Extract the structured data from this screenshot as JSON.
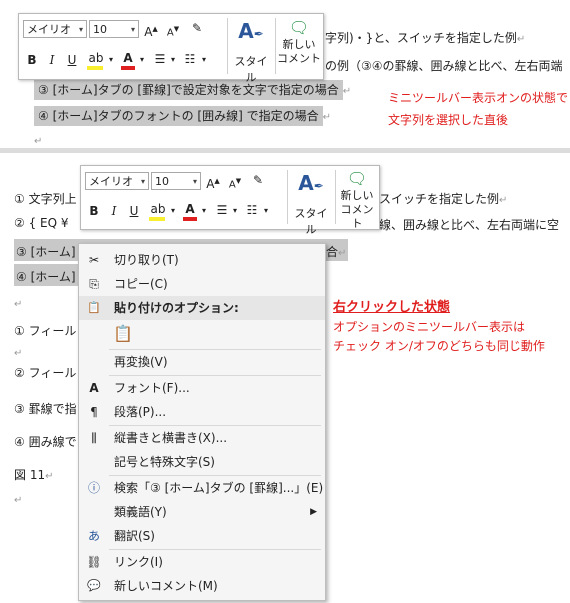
{
  "top_section": {
    "lines": [
      {
        "text": "字列)・}と、スイッチを指定した例",
        "mark": "↵"
      },
      {
        "text": "の例（③④の罫線、囲み線と比べ、左右両端",
        "mark": ""
      },
      {
        "text": "③ [ホーム]タブの [罫線]で設定対象を文字で指定の場合",
        "mark": "↵"
      },
      {
        "text": "④ [ホーム]タブのフォントの [囲み線] で指定の場合",
        "mark": "↵"
      },
      {
        "text": "",
        "mark": "↵"
      }
    ],
    "annotation": [
      "ミニツールバー表示オンの状態で",
      "文字列を選択した直後"
    ]
  },
  "bottom_section": {
    "lines": [
      {
        "text": "① 文字列上",
        "tail": "スイッチを指定した例",
        "mark": "↵"
      },
      {
        "text": "② { EQ ¥",
        "tail": "線、囲み線と比べ、左右両端に空",
        "mark": ""
      },
      {
        "text": "③ [ホーム]",
        "tail": "合",
        "mark": "↵"
      },
      {
        "text": "④ [ホーム]",
        "tail": "",
        "mark": ""
      },
      {
        "text": "",
        "mark": "↵"
      },
      {
        "text": "① フィール",
        "mark": ""
      },
      {
        "text": "",
        "mark": "↵"
      },
      {
        "text": "② フィール",
        "mark": ""
      },
      {
        "text": "③ 罫線で指",
        "mark": ""
      },
      {
        "text": "④ 囲み線で",
        "mark": ""
      },
      {
        "text": "図 11",
        "mark": "↵"
      },
      {
        "text": "",
        "mark": "↵"
      }
    ],
    "annotation_title": "右クリックした状態",
    "annotation": [
      "オプションのミニツールバー表示は",
      "チェック オン/オフのどちらも同じ動作"
    ]
  },
  "mini_toolbar": {
    "font": "メイリオ",
    "size": "10",
    "style_label": "スタイル",
    "comment_label": [
      "新しい",
      "コメント"
    ],
    "accent": "#2b579a",
    "highlight_color": "#f7ef2f",
    "font_color": "#e02020",
    "icons": [
      "grow-font-icon",
      "shrink-font-icon",
      "clear-format-icon",
      "bold-icon",
      "italic-icon",
      "underline-icon",
      "highlight-icon",
      "font-color-icon",
      "bullets-icon",
      "numbering-icon",
      "styles-icon",
      "new-comment-icon"
    ]
  },
  "context_menu": {
    "items": [
      {
        "icon": "✂",
        "label": "切り取り(T)",
        "name": "cut"
      },
      {
        "icon": "⎘",
        "label": "コピー(C)",
        "name": "copy"
      },
      {
        "icon": "📋",
        "label": "貼り付けのオプション:",
        "name": "paste-options",
        "header": true
      },
      {
        "icon": "",
        "label": "再変換(V)",
        "name": "reconvert"
      },
      {
        "icon": "A",
        "label": "フォント(F)...",
        "name": "font"
      },
      {
        "icon": "¶",
        "label": "段落(P)...",
        "name": "paragraph"
      },
      {
        "icon": "⫼",
        "label": "縦書きと横書き(X)...",
        "name": "text-direction"
      },
      {
        "icon": "",
        "label": "記号と特殊文字(S)",
        "name": "symbols"
      },
      {
        "icon": "ⓘ",
        "label": "検索「③ [ホーム]タブの [罫線]...」(E)",
        "name": "search"
      },
      {
        "icon": "",
        "label": "類義語(Y)",
        "name": "synonyms",
        "submenu": true
      },
      {
        "icon": "あ",
        "label": "翻訳(S)",
        "name": "translate"
      },
      {
        "icon": "⛓",
        "label": "リンク(I)",
        "name": "link"
      },
      {
        "icon": "💬",
        "label": "新しいコメント(M)",
        "name": "new-comment"
      }
    ]
  }
}
